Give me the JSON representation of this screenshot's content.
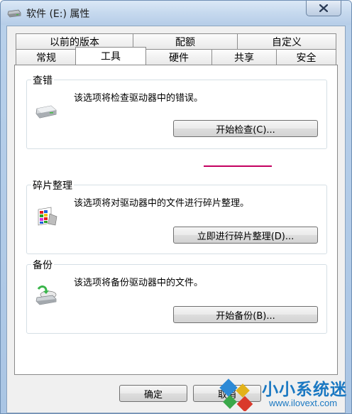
{
  "window": {
    "title": "软件 (E:) 属性"
  },
  "tabs_row1": [
    {
      "label": "以前的版本"
    },
    {
      "label": "配额"
    },
    {
      "label": "自定义"
    }
  ],
  "tabs_row2": [
    {
      "label": "常规"
    },
    {
      "label": "工具",
      "active": true
    },
    {
      "label": "硬件"
    },
    {
      "label": "共享"
    },
    {
      "label": "安全"
    }
  ],
  "groups": {
    "error_check": {
      "label": "查错",
      "description": "该选项将检查驱动器中的错误。",
      "button": "开始检查(C)...",
      "icon": "drive-icon"
    },
    "defrag": {
      "label": "碎片整理",
      "description": "该选项将对驱动器中的文件进行碎片整理。",
      "button": "立即进行碎片整理(D)...",
      "icon": "defrag-icon"
    },
    "backup": {
      "label": "备份",
      "description": "该选项将备份驱动器中的文件。",
      "button": "开始备份(B)...",
      "icon": "backup-icon"
    }
  },
  "footer": {
    "ok_label": "确定",
    "cancel_label": "取消"
  },
  "watermark": {
    "brand": "小小系统迷",
    "url": "www.ilovext.com"
  },
  "colors": {
    "highlight_underline": "#c40060",
    "watermark_blue": "#1a78c2"
  }
}
